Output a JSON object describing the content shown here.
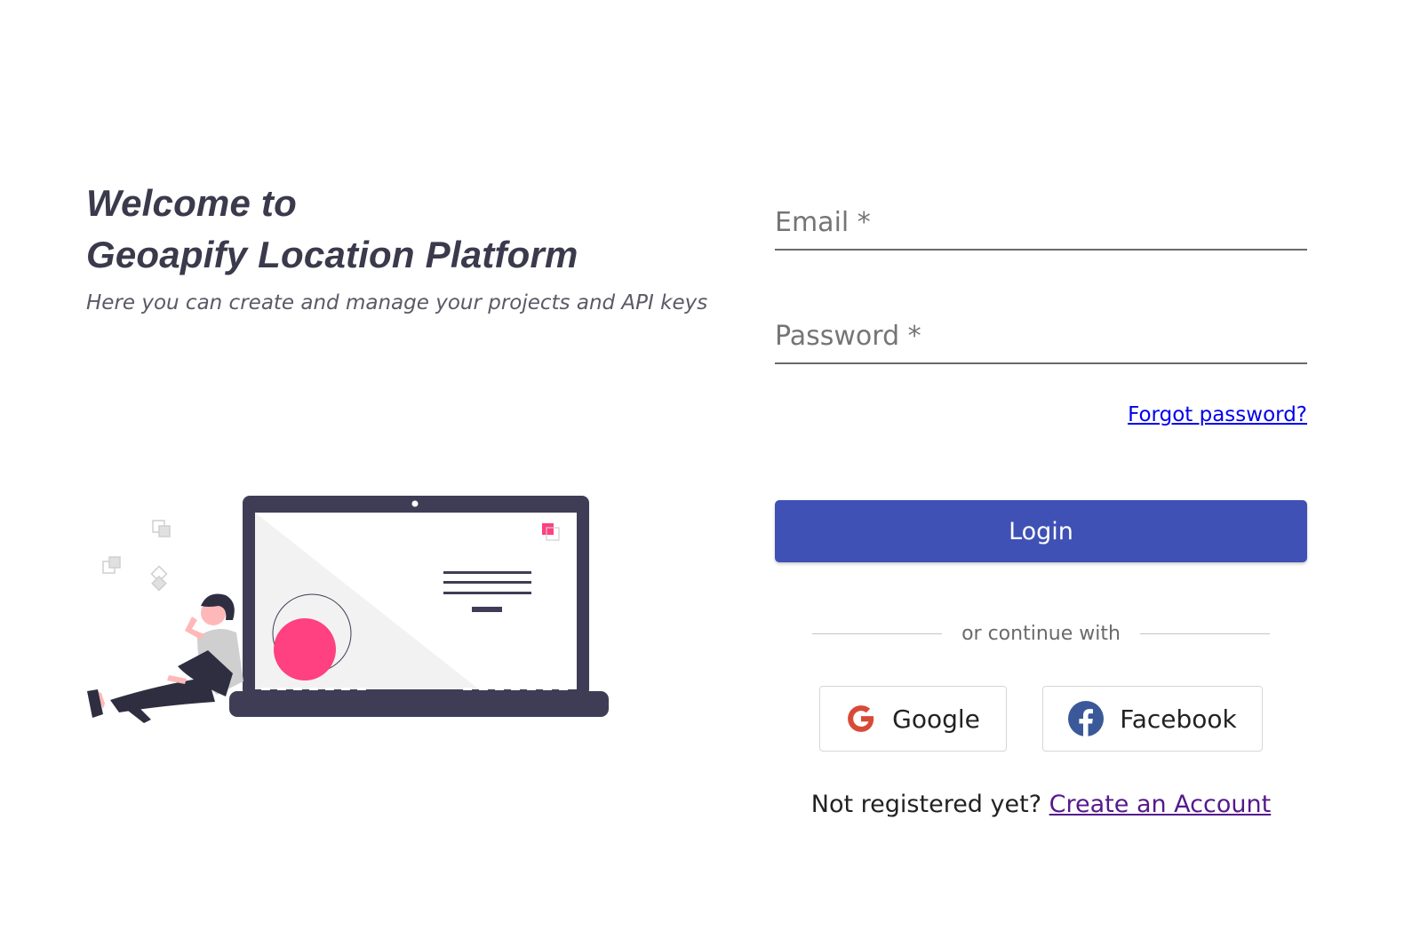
{
  "welcome": {
    "line1": "Welcome to",
    "line2": "Geoapify Location Platform",
    "subtitle": "Here you can create and manage your projects and API keys"
  },
  "form": {
    "email_placeholder": "Email *",
    "password_placeholder": "Password *",
    "forgot_link": "Forgot password?",
    "login_label": "Login",
    "divider_text": "or continue with",
    "google_label": "Google",
    "facebook_label": "Facebook",
    "register_prompt": "Not registered yet?",
    "register_link": "Create an Account"
  },
  "icons": {
    "google": "google-g-icon",
    "facebook": "facebook-f-icon"
  },
  "colors": {
    "primary": "#3f51b5",
    "accent_pink": "#ff4081",
    "dark": "#3f3d56",
    "link": "#0000ee",
    "visited_link": "#551a8b"
  }
}
